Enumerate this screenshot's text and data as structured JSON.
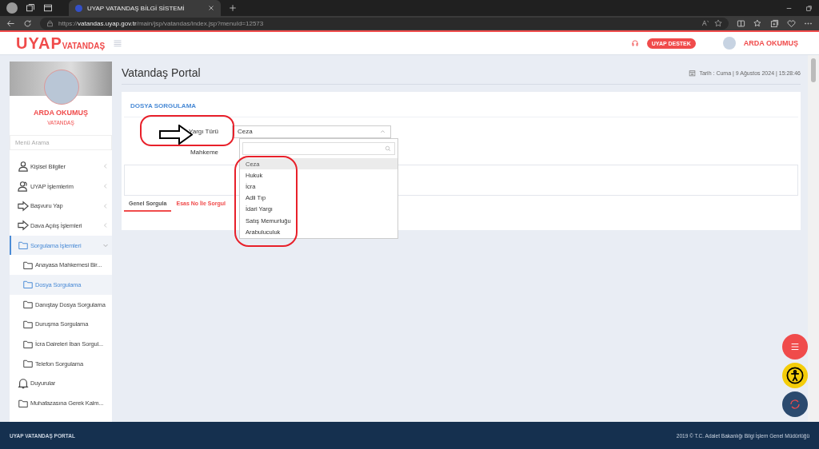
{
  "browser": {
    "tab_title": "UYAP VATANDAŞ BİLGİ SİSTEMİ",
    "url_prefix": "https://",
    "url_host": "vatandas.uyap.gov.tr",
    "url_path": "/main/jsp/vatandas/index.jsp?menuId=12573"
  },
  "header": {
    "logo_main": "UYAP",
    "logo_sub": "VATANDAŞ",
    "support_button": "UYAP DESTEK",
    "user_name": "ARDA OKUMUŞ"
  },
  "sidebar": {
    "profile_name": "ARDA OKUMUŞ",
    "profile_role": "VATANDAŞ",
    "search_placeholder": "Menü Arama",
    "items": [
      {
        "kind": "person",
        "label": "Kişisel Bilgiler",
        "expanded": false,
        "selected": false
      },
      {
        "kind": "people",
        "label": "UYAP İşlemlerim",
        "expanded": false,
        "selected": false
      },
      {
        "kind": "arrow",
        "label": "Başvuru Yap",
        "expanded": false,
        "selected": false
      },
      {
        "kind": "arrow",
        "label": "Dava Açılış İşlemleri",
        "expanded": false,
        "selected": false
      },
      {
        "kind": "folder",
        "label": "Sorgulama İşlemleri",
        "expanded": true,
        "selected": true,
        "children": [
          {
            "kind": "folder",
            "label": "Anayasa Mahkemesi Bir...",
            "selected": false
          },
          {
            "kind": "folder",
            "label": "Dosya Sorgulama",
            "selected": true
          },
          {
            "kind": "folder",
            "label": "Danıştay Dosya Sorgulama",
            "selected": false
          },
          {
            "kind": "folder",
            "label": "Duruşma Sorgulama",
            "selected": false
          },
          {
            "kind": "folder",
            "label": "İcra Daireleri İban Sorgul...",
            "selected": false
          },
          {
            "kind": "folder",
            "label": "Telefon Sorgulama",
            "selected": false
          }
        ]
      },
      {
        "kind": "bell",
        "label": "Duyurular",
        "selected": false
      },
      {
        "kind": "folder",
        "label": "Muhafazasına Gerek Kalm...",
        "selected": false
      }
    ]
  },
  "page": {
    "title": "Vatandaş Portal",
    "date": "Tarih : Cuma | 9 Ağustos 2024 | 15:28:46"
  },
  "panel": {
    "title": "DOSYA SORGULAMA",
    "fields": [
      {
        "label": "Yargı Türü",
        "value": "Ceza"
      },
      {
        "label": "Mahkeme"
      }
    ],
    "tabs": [
      {
        "label": "Genel Sorgula",
        "selected": true
      },
      {
        "label": "Esas No İle Sorgul",
        "selected": false
      }
    ],
    "dropdown": {
      "options": [
        {
          "label": "Ceza",
          "selected": true
        },
        {
          "label": "Hukuk",
          "selected": false
        },
        {
          "label": "İcra",
          "selected": false
        },
        {
          "label": "Adli Tıp",
          "selected": false
        },
        {
          "label": "İdari Yargı",
          "selected": false
        },
        {
          "label": "Satış Memurluğu",
          "selected": false
        },
        {
          "label": "Arabuluculuk",
          "selected": false
        }
      ]
    }
  },
  "footer": {
    "left": "UYAP VATANDAŞ PORTAL",
    "right": "2019 © T.C. Adalet Bakanlığı Bilgi İşlem Genel Müdürlüğü"
  }
}
